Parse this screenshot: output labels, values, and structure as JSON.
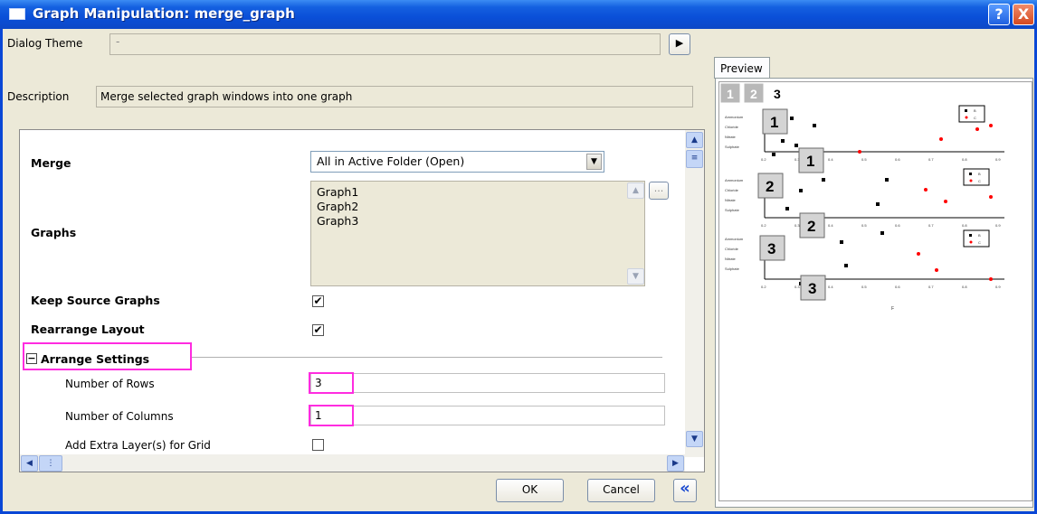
{
  "window": {
    "title": "Graph Manipulation: merge_graph",
    "help_label": "?",
    "close_label": "X"
  },
  "dialog_theme": {
    "label": "Dialog Theme",
    "value": "-",
    "menu_arrow": "▶"
  },
  "description": {
    "label": "Description",
    "value": "Merge selected graph windows into one graph"
  },
  "props": {
    "merge_label": "Merge",
    "merge_value": "All in Active Folder (Open)",
    "graphs_label": "Graphs",
    "graphs": [
      "Graph1",
      "Graph2",
      "Graph3"
    ],
    "browse_label": "...",
    "keep_source_label": "Keep Source Graphs",
    "keep_source_checked": "✔",
    "rearrange_label": "Rearrange Layout",
    "rearrange_checked": "✔",
    "arrange_toggle": "−",
    "arrange_label": "Arrange Settings",
    "rows_label": "Number of Rows",
    "rows_value": "3",
    "cols_label": "Number of Columns",
    "cols_value": "1",
    "extra_layers_label": "Add Extra Layer(s) for Grid"
  },
  "buttons": {
    "ok": "OK",
    "cancel": "Cancel",
    "collapse": "«"
  },
  "preview": {
    "tab_label": "Preview",
    "page_tabs": [
      "1",
      "2",
      "3"
    ],
    "layer_labels": [
      "1",
      "1",
      "2",
      "2",
      "3",
      "3"
    ],
    "y_ticks": [
      "Ammonium",
      "Chloride",
      "Nitrate",
      "Sulphate"
    ],
    "x_ticks": [
      "0.2",
      "0.3",
      "0.4",
      "0.5",
      "0.6",
      "0.7",
      "0.8",
      "0.9"
    ],
    "x_axis_letter": "F",
    "colors": {
      "series1": "#000000",
      "series2": "#ff0000"
    }
  },
  "highlight_color": "#ff2ce0"
}
